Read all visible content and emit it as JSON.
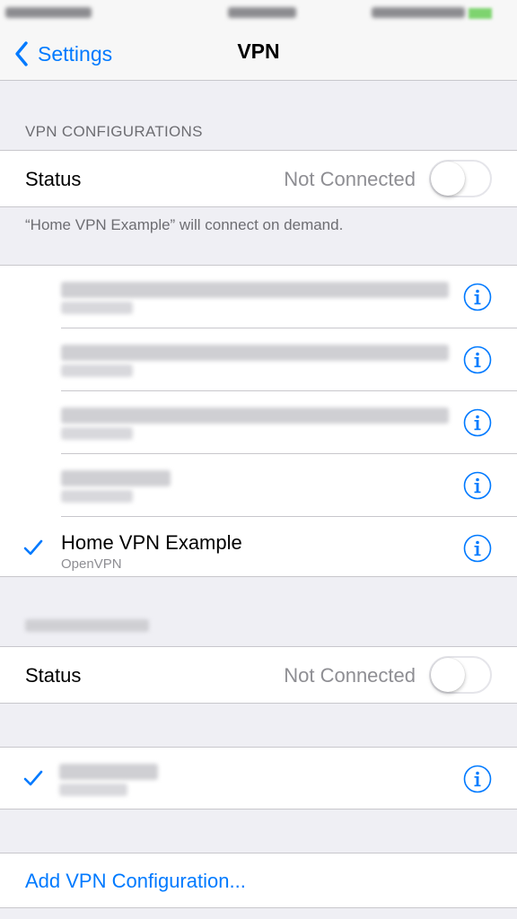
{
  "nav": {
    "back_label": "Settings",
    "title": "VPN"
  },
  "vpn_configurations": {
    "header": "VPN CONFIGURATIONS",
    "status_label": "Status",
    "status_value": "Not Connected",
    "status_on": false,
    "footer": "“Home VPN Example” will connect on demand."
  },
  "vpn_list": [
    {
      "name": "",
      "type": "",
      "selected": false
    },
    {
      "name": "",
      "type": "",
      "selected": false
    },
    {
      "name": "",
      "type": "",
      "selected": false
    },
    {
      "name": "",
      "type": "",
      "selected": false
    },
    {
      "name": "Home VPN Example",
      "type": "OpenVPN",
      "selected": true
    }
  ],
  "second_section": {
    "status_label": "Status",
    "status_value": "Not Connected",
    "status_on": false,
    "items": [
      {
        "name": "",
        "selected": true
      }
    ]
  },
  "add_configuration_label": "Add VPN Configuration...",
  "colors": {
    "accent": "#007aff",
    "background": "#efeff4",
    "secondary_text": "#8e8e93",
    "separator": "#c8c7cc"
  },
  "icons": {
    "back": "chevron-left-icon",
    "info": "info-icon",
    "check": "checkmark-icon"
  }
}
